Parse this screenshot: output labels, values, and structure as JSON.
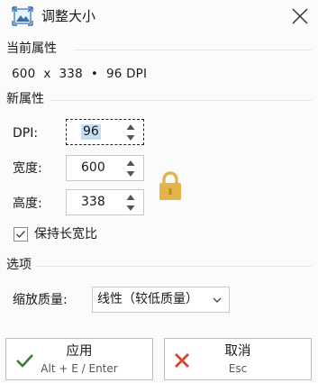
{
  "window": {
    "title": "调整大小"
  },
  "current": {
    "heading": "当前属性",
    "info": "600  x  338  •  96 DPI"
  },
  "new_props": {
    "heading": "新属性",
    "dpi_label": "DPI:",
    "dpi_value": "96",
    "width_label": "宽度:",
    "width_value": "600",
    "height_label": "高度:",
    "height_value": "338",
    "keep_ratio_label": "保持长宽比",
    "keep_ratio_checked": true
  },
  "options": {
    "heading": "选项",
    "quality_label": "缩放质量:",
    "quality_value": "线性（较低质量）"
  },
  "buttons": {
    "apply_label": "应用",
    "apply_shortcut": "Alt + E / Enter",
    "cancel_label": "取消",
    "cancel_shortcut": "Esc"
  },
  "colors": {
    "check_green": "#3b7d3b",
    "cancel_red": "#d9462f",
    "lock_gold": "#e2b44a",
    "app_icon_blue": "#2f6fb5"
  },
  "icons": [
    "resize-image-icon",
    "close-icon",
    "lock-icon",
    "checkmark-icon",
    "x-mark-icon",
    "spinner-up-arrow-icon",
    "spinner-down-arrow-icon",
    "dropdown-chevron-icon"
  ]
}
